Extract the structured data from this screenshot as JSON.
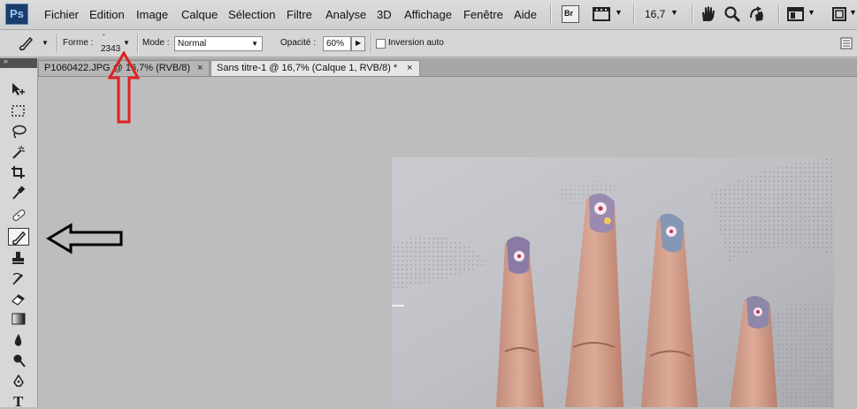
{
  "app": {
    "logo": "Ps"
  },
  "menubar": {
    "items": [
      "Fichier",
      "Edition",
      "Image",
      "Calque",
      "Sélection",
      "Filtre",
      "Analyse",
      "3D",
      "Affichage",
      "Fenêtre",
      "Aide"
    ],
    "bridge_label": "Br",
    "zoom_value": "16,7",
    "icons": [
      "bridge-icon",
      "film-view-icon",
      "hand-icon",
      "zoom-icon",
      "rotate-view-icon",
      "arrange-documents-icon",
      "screen-mode-icon"
    ]
  },
  "options": {
    "forme_label": "Forme :",
    "brush_size": "2343",
    "mode_label": "Mode :",
    "mode_value": "Normal",
    "opacite_label": "Opacité :",
    "opacite_value": "60%",
    "inversion_label": "Inversion auto",
    "inversion_checked": false
  },
  "tabs": [
    {
      "title": "P1060422.JPG @ 16,7% (RVB/8)",
      "active": false
    },
    {
      "title": "Sans titre-1 @ 16,7% (Calque 1, RVB/8) *",
      "active": true
    }
  ],
  "toolbox": {
    "tools": [
      "move",
      "marquee",
      "lasso",
      "magic-wand",
      "crop",
      "eyedropper",
      "healing",
      "brush",
      "clone-stamp",
      "history-brush",
      "eraser",
      "gradient",
      "blur",
      "dodge",
      "pen",
      "type"
    ],
    "selected": "brush"
  },
  "annotations": {
    "red_arrow_color": "#e02020",
    "black_arrow_color": "#000000"
  }
}
